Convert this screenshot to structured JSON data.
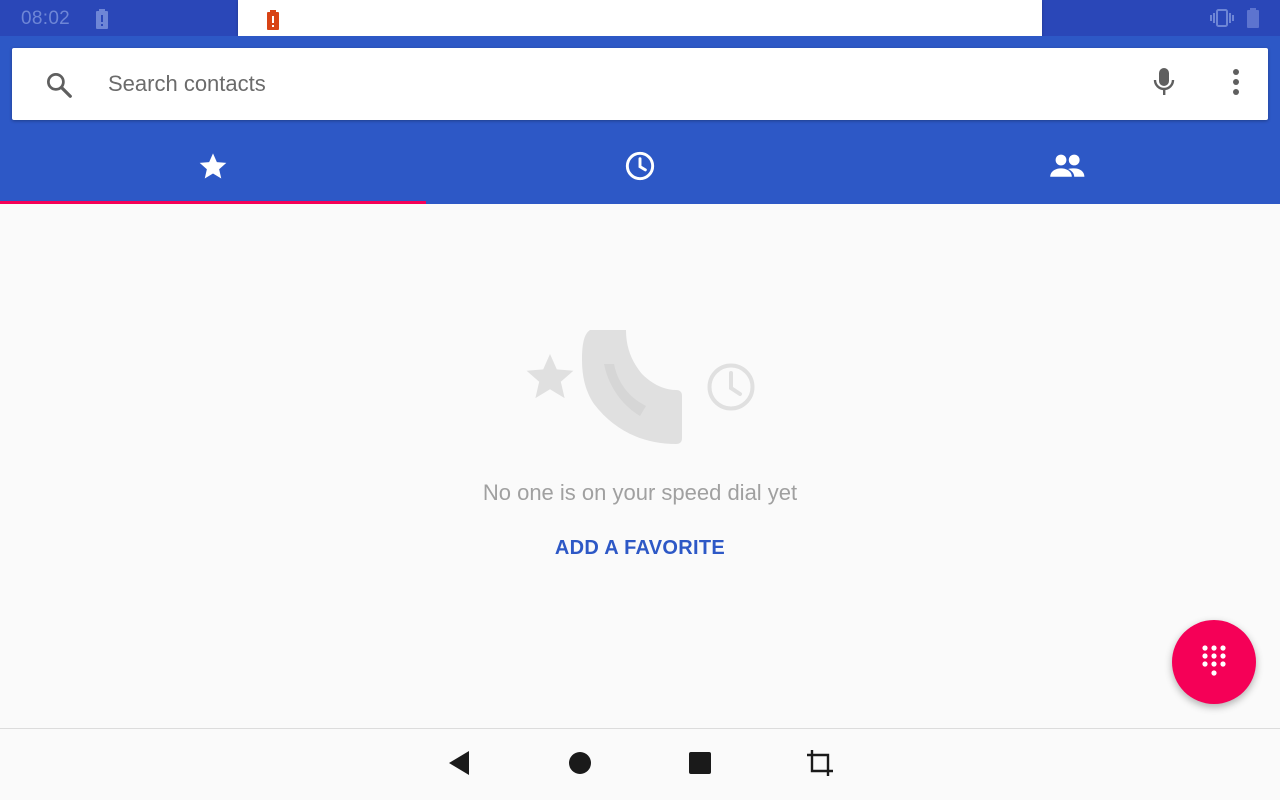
{
  "status_bar": {
    "time": "08:02"
  },
  "search": {
    "placeholder": "Search contacts"
  },
  "tabs": [
    {
      "icon": "star-icon",
      "selected": true
    },
    {
      "icon": "clock-icon",
      "selected": false
    },
    {
      "icon": "people-icon",
      "selected": false
    }
  ],
  "empty_state": {
    "message": "No one is on your speed dial yet",
    "action_label": "ADD A FAVORITE"
  },
  "colors": {
    "status_bar": "#2a47b8",
    "app_bar": "#2d58c6",
    "accent": "#f50057",
    "link": "#2d58c6",
    "alert": "#d84315"
  },
  "icons": {
    "search": "search-icon",
    "mic": "mic-icon",
    "more": "more-vert-icon",
    "dialpad": "dialpad-icon",
    "back": "back-icon",
    "home": "home-icon",
    "recents": "recents-icon",
    "rotate": "rotate-icon"
  }
}
